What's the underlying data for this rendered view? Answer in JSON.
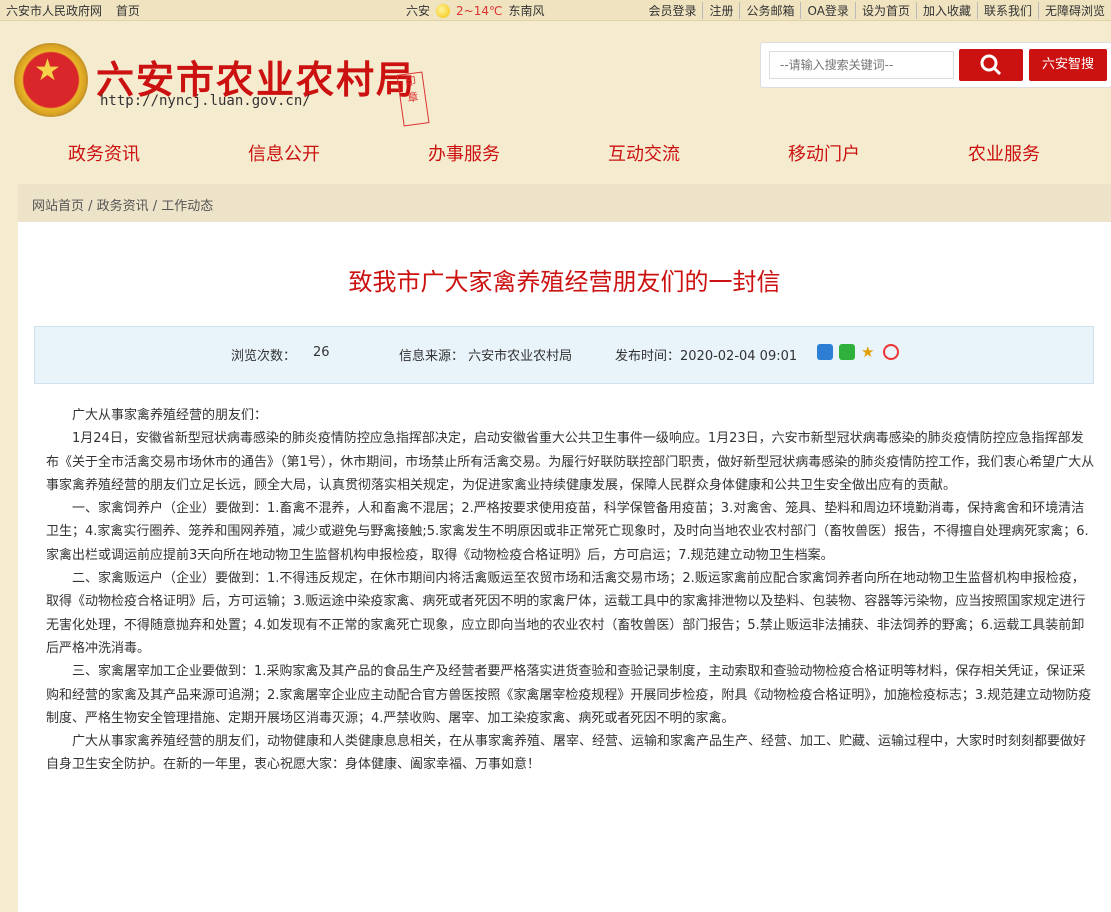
{
  "topbar": {
    "links_left": [
      "六安市人民政府网",
      "首页"
    ],
    "weather_city": "六安",
    "weather_temp": "2~14℃",
    "weather_wind": "东南风",
    "links_right": [
      "会员登录",
      "注册",
      "公务邮箱",
      "OA登录",
      "设为首页",
      "加入收藏",
      "联系我们",
      "无障碍浏览"
    ]
  },
  "header": {
    "title": "六安市农业农村局",
    "url": "http://nyncj.luan.gov.cn/",
    "search_placeholder": "--请输入搜索关键词--",
    "smart_search": "六安智搜"
  },
  "nav": [
    "政务资讯",
    "信息公开",
    "办事服务",
    "互动交流",
    "移动门户",
    "农业服务"
  ],
  "breadcrumb": "网站首页 / 政务资讯 / 工作动态",
  "article": {
    "title": "致我市广大家禽养殖经营朋友们的一封信",
    "views_label": "浏览次数：",
    "views": "26",
    "source": "信息来源： 六安市农业农村局",
    "date": "发布时间：2020-02-04 09:01",
    "paragraphs": [
      "广大从事家禽养殖经营的朋友们：",
      "1月24日，安徽省新型冠状病毒感染的肺炎疫情防控应急指挥部决定，启动安徽省重大公共卫生事件一级响应。1月23日，六安市新型冠状病毒感染的肺炎疫情防控应急指挥部发布《关于全市活禽交易市场休市的通告》（第1号），休市期间，市场禁止所有活禽交易。为履行好联防联控部门职责，做好新型冠状病毒感染的肺炎疫情防控工作，我们衷心希望广大从事家禽养殖经营的朋友们立足长远，顾全大局，认真贯彻落实相关规定，为促进家禽业持续健康发展，保障人民群众身体健康和公共卫生安全做出应有的贡献。",
      "一、家禽饲养户（企业）要做到：1.畜禽不混养，人和畜禽不混居；2.严格按要求使用疫苗，科学保管备用疫苗；3.对禽舍、笼具、垫料和周边环境勤消毒，保持禽舍和环境清洁卫生；4.家禽实行圈养、笼养和围网养殖，减少或避免与野禽接触;5.家禽发生不明原因或非正常死亡现象时，及时向当地农业农村部门（畜牧兽医）报告，不得擅自处理病死家禽；6.家禽出栏或调运前应提前3天向所在地动物卫生监督机构申报检疫，取得《动物检疫合格证明》后，方可启运；7.规范建立动物卫生档案。",
      "二、家禽贩运户（企业）要做到：1.不得违反规定，在休市期间内将活禽贩运至农贸市场和活禽交易市场；2.贩运家禽前应配合家禽饲养者向所在地动物卫生监督机构申报检疫，取得《动物检疫合格证明》后，方可运输；3.贩运途中染疫家禽、病死或者死因不明的家禽尸体，运载工具中的家禽排泄物以及垫料、包装物、容器等污染物，应当按照国家规定进行无害化处理，不得随意抛弃和处置；4.如发现有不正常的家禽死亡现象，应立即向当地的农业农村（畜牧兽医）部门报告；5.禁止贩运非法捕获、非法饲养的野禽；6.运载工具装前卸后严格冲洗消毒。",
      "三、家禽屠宰加工企业要做到：1.采购家禽及其产品的食品生产及经营者要严格落实进货查验和查验记录制度，主动索取和查验动物检疫合格证明等材料，保存相关凭证，保证采购和经营的家禽及其产品来源可追溯；2.家禽屠宰企业应主动配合官方兽医按照《家禽屠宰检疫规程》开展同步检疫，附具《动物检疫合格证明》，加施检疫标志；3.规范建立动物防疫制度、严格生物安全管理措施、定期开展场区消毒灭源；4.严禁收购、屠宰、加工染疫家禽、病死或者死因不明的家禽。",
      "广大从事家禽养殖经营的朋友们，动物健康和人类健康息息相关，在从事家禽养殖、屠宰、经营、运输和家禽产品生产、经营、加工、贮藏、运输过程中，大家时时刻刻都要做好自身卫生安全防护。在新的一年里，衷心祝愿大家：身体健康、阖家幸福、万事如意！"
    ]
  },
  "colors": {
    "brand_red": "#cc1111",
    "page_bg": "#f5ecd0",
    "meta_bg": "#e8f3fa"
  }
}
